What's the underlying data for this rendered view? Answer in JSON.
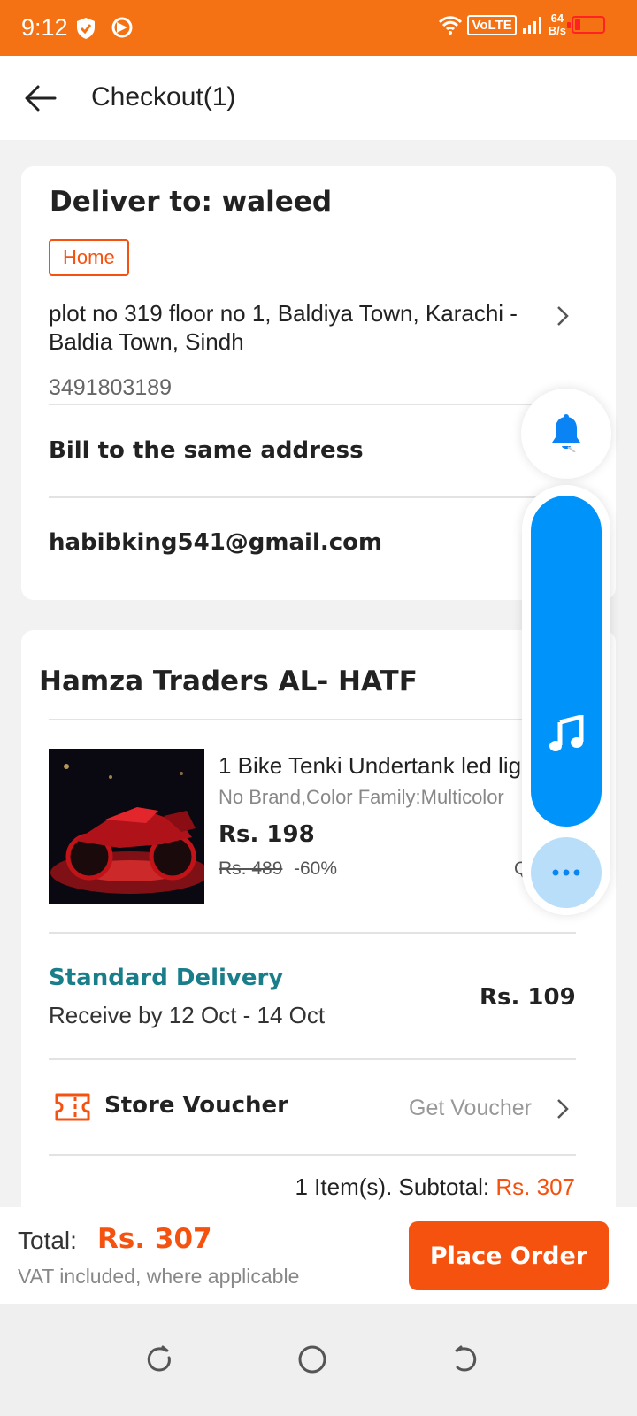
{
  "status_bar": {
    "time": "9:12",
    "network": "VoLTE",
    "speed_value": "64",
    "speed_unit": "B/s",
    "battery_color": "#ff2222"
  },
  "header": {
    "title": "Checkout(1)"
  },
  "shipping": {
    "deliver_to": "Deliver to: waleed",
    "tag": "Home",
    "address": "plot no 319 floor no 1, Baldiya Town, Karachi - Baldia Town, Sindh",
    "phone": "3491803189",
    "bill_label": "Bill to the same address",
    "email": "habibking541@gmail.com"
  },
  "order": {
    "store_name": "Hamza Traders AL- HATF",
    "product": {
      "title": "1 Bike Tenki Undertank led light",
      "variant": "No Brand,Color Family:Multicolor",
      "price": "Rs. 198",
      "original_price": "Rs. 489",
      "discount": "-60%",
      "qty": "Qty: 1"
    },
    "delivery": {
      "title": "Standard Delivery",
      "date": "Receive by 12 Oct - 14 Oct",
      "price": "Rs. 109"
    },
    "voucher": {
      "label": "Store Voucher",
      "link": "Get Voucher"
    },
    "subtotal_label": "1 Item(s). Subtotal:",
    "subtotal_amount": "Rs. 307"
  },
  "footer": {
    "total_label": "Total:",
    "total_amount": "Rs. 307",
    "vat_note": "VAT included, where applicable",
    "place_order": "Place Order"
  },
  "colors": {
    "brand_orange": "#f5510f",
    "status_bar": "#f57214",
    "delivery_teal": "#1a7e8a",
    "floating_blue": "#0093fa"
  },
  "icons": [
    "shield-icon",
    "app-icon",
    "wifi-icon",
    "signal-icon",
    "back-arrow-icon",
    "chevron-right-icon",
    "bell-icon",
    "music-icon",
    "more-dots-icon",
    "voucher-ticket-icon",
    "recents-icon",
    "home-icon",
    "back-icon"
  ]
}
